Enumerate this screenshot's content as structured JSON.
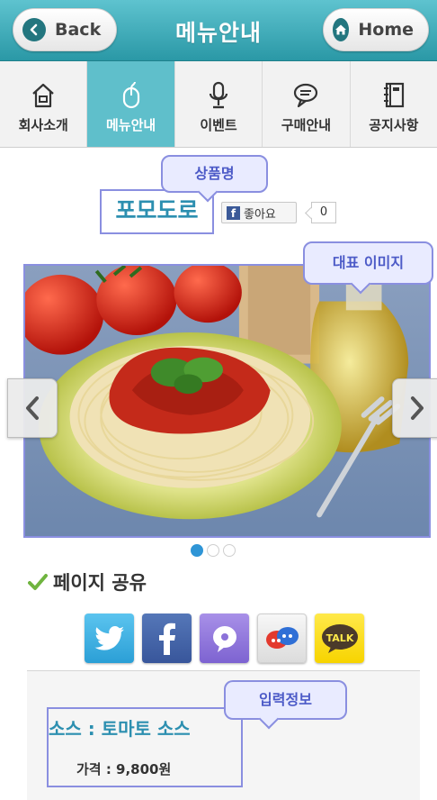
{
  "header": {
    "back_label": "Back",
    "title": "메뉴안내",
    "home_label": "Home"
  },
  "tabs": [
    {
      "label": "회사소개",
      "icon": "house-icon",
      "active": false
    },
    {
      "label": "메뉴안내",
      "icon": "mouse-icon",
      "active": true
    },
    {
      "label": "이벤트",
      "icon": "microphone-icon",
      "active": false
    },
    {
      "label": "구매안내",
      "icon": "speech-bubble-icon",
      "active": false
    },
    {
      "label": "공지사항",
      "icon": "notebook-icon",
      "active": false
    }
  ],
  "product": {
    "name": "포모도로",
    "like_label": "좋아요",
    "like_count": "0"
  },
  "callouts": {
    "product_name": "상품명",
    "main_image": "대표 이미지",
    "input_info": "입력정보"
  },
  "slider": {
    "dots": 3,
    "active_dot": 0
  },
  "share": {
    "title": "페이지 공유",
    "talk_label": "TALK",
    "buttons": [
      "twitter-icon",
      "facebook-icon",
      "kakaostory-icon",
      "chat-icon",
      "kakaotalk-icon"
    ]
  },
  "info": {
    "sauce": "소스 : 토마토 소스",
    "price": "가격 : 9,800원"
  },
  "colors": {
    "header": "#3aa9b6",
    "active_tab": "#5fbfcb",
    "accent_text": "#2c8fb0",
    "annotation": "#8a8fe0"
  }
}
